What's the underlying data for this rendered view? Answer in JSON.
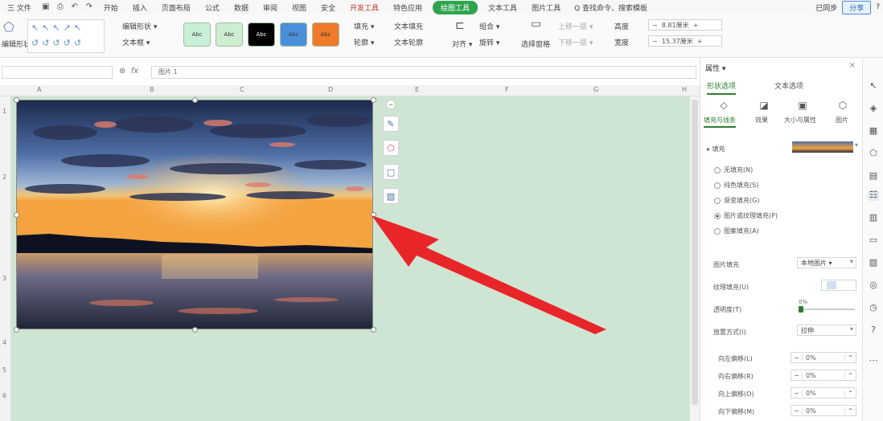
{
  "menubar": {
    "file_label": "三 文件",
    "items": [
      {
        "label": "开始"
      },
      {
        "label": "插入"
      },
      {
        "label": "页面布局"
      },
      {
        "label": "公式"
      },
      {
        "label": "数据"
      },
      {
        "label": "审阅"
      },
      {
        "label": "视图"
      },
      {
        "label": "安全"
      },
      {
        "label": "开发工具",
        "special": true
      },
      {
        "label": "特色应用"
      },
      {
        "label": "绘图工具",
        "active": true
      },
      {
        "label": "文本工具"
      },
      {
        "label": "图片工具"
      }
    ],
    "search_label": "Q 查找命令、搜索模板",
    "share_label": "已同步",
    "cooperate_label": "分享",
    "help_label": "?"
  },
  "ribbon": {
    "shape_label": "编辑形状",
    "shapes_sample": "↖↖↖↗↖ ↺↺↺↺↺",
    "edit_shape": "编辑形状 ▾",
    "text_box": "文本框 ▾",
    "style_buttons": [
      {
        "text": "Abc",
        "color": "#c9efd6"
      },
      {
        "text": "Abc",
        "color": "#cdeed0"
      },
      {
        "text": "Abc",
        "color": "#000000"
      },
      {
        "text": "Abc",
        "color": "#4a90d9"
      },
      {
        "text": "Abc",
        "color": "#f07a2a"
      }
    ],
    "fill_label": "填充 ▾",
    "outline_label": "轮廓 ▾",
    "text_fill": "文本填充",
    "text_outline": "文本轮廓",
    "align_label": "对齐 ▾",
    "rotate_label": "旋转 ▾",
    "group_label": "组合 ▾",
    "select_pane": "选择窗格",
    "up_layer": "上移一层 ▾",
    "down_layer": "下移一层 ▾",
    "height_label": "高度",
    "width_label": "宽度",
    "height_value": "8.81厘米",
    "width_value": "15.37厘米"
  },
  "formula": {
    "input_value": "图片 1"
  },
  "sheet": {
    "columns": [
      "A",
      "B",
      "C",
      "D",
      "E",
      "F",
      "G",
      "H"
    ],
    "rows": [
      "1",
      "2",
      "3",
      "4",
      "5",
      "6"
    ]
  },
  "panel": {
    "title": "属性 ▾",
    "tabs": [
      {
        "label": "形状选项",
        "active": true
      },
      {
        "label": "文本选项"
      }
    ],
    "subtabs": [
      {
        "label": "填充与线条",
        "active": true
      },
      {
        "label": "效果"
      },
      {
        "label": "大小与属性"
      },
      {
        "label": "图片"
      }
    ],
    "fill_section": "▸ 填充",
    "fill_options": [
      {
        "label": "无填充(N)"
      },
      {
        "label": "纯色填充(S)"
      },
      {
        "label": "渐变填充(G)"
      },
      {
        "label": "图片或纹理填充(P)",
        "checked": true
      },
      {
        "label": "图案填充(A)"
      }
    ],
    "picture_fill_label": "图片填充",
    "picture_fill_value": "本地图片 ▾",
    "texture_label": "纹理填充(U)",
    "transparency_label": "透明度(T)",
    "transparency_value": "0%",
    "place_label": "放置方式(I)",
    "place_value": "拉伸",
    "offsets": [
      {
        "label": "向左偏移(L)",
        "value": "0%"
      },
      {
        "label": "向右偏移(R)",
        "value": "0%"
      },
      {
        "label": "向上偏移(O)",
        "value": "0%"
      },
      {
        "label": "向下偏移(M)",
        "value": "0%"
      }
    ]
  },
  "colors": {
    "accent": "#2e7d32",
    "canvas": "#cfe5d3",
    "arrow": "#e8262a"
  }
}
